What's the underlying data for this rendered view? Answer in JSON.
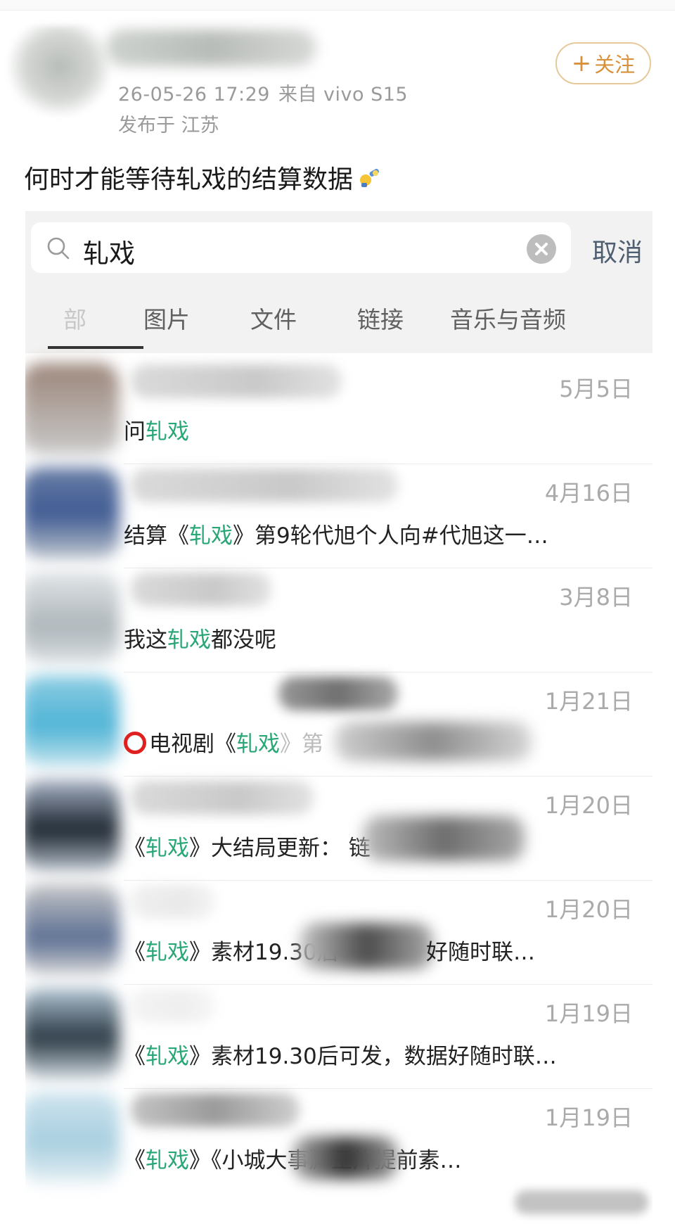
{
  "post": {
    "meta_time": "26-05-26 17:29",
    "meta_from": "来自 vivo S15",
    "location": "发布于 江苏",
    "follow_label": "关注",
    "follow_plus": "+",
    "text": "何时才能等待轧戏的结算数据",
    "emoji_icon": "cheering-emoji-icon"
  },
  "search": {
    "query": "轧戏",
    "cancel_label": "取消"
  },
  "tabs": [
    {
      "label": "部"
    },
    {
      "label": "图片"
    },
    {
      "label": "文件"
    },
    {
      "label": "链接"
    },
    {
      "label": "音乐与音频"
    }
  ],
  "results": [
    {
      "date": "5月5日",
      "pre": "问",
      "hl": "轧戏",
      "post": ""
    },
    {
      "date": "4月16日",
      "pre": "结算《",
      "hl": "轧戏",
      "post": "》第9轮代旭个人向#代旭这一…"
    },
    {
      "date": "3月8日",
      "pre": "我这",
      "hl": "轧戏",
      "post": "都没呢"
    },
    {
      "date": "1月21日",
      "pre": "电视剧《",
      "hl": "轧戏",
      "post": "》第"
    },
    {
      "date": "1月20日",
      "pre": "《",
      "hl": "轧戏",
      "post": "》大结局更新： 链"
    },
    {
      "date": "1月20日",
      "pre": "《",
      "hl": "轧戏",
      "post": "》素材19.30后",
      "tail": "好随时联…"
    },
    {
      "date": "1月19日",
      "pre": "《",
      "hl": "轧戏",
      "post": "》素材19.30后可发，数据好随时联…"
    },
    {
      "date": "1月19日",
      "pre": "《",
      "hl": "轧戏",
      "post": "》《小城大事》正片提前素…"
    }
  ],
  "colors": {
    "highlight": "#2aa776",
    "follow": "#d8913a",
    "cancel": "#4f5e70"
  }
}
